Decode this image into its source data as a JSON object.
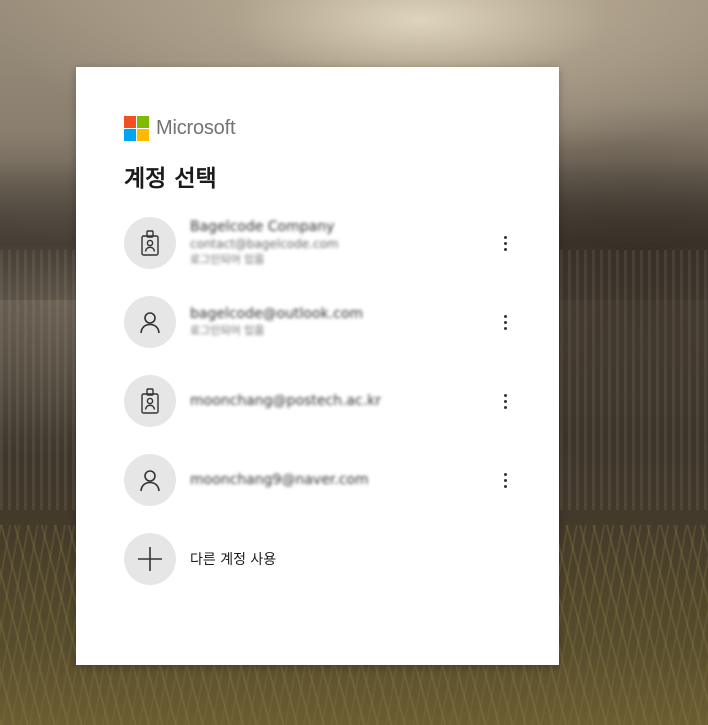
{
  "brand": {
    "name": "Microsoft",
    "logo_colors": [
      "#f25022",
      "#7fba00",
      "#00a4ef",
      "#ffb900"
    ]
  },
  "title": "계정 선택",
  "accounts": [
    {
      "type": "work",
      "icon": "badge-icon",
      "name": "Bagelcode Company",
      "email": "contact@bagelcode.com",
      "status": "로그인되어 있음"
    },
    {
      "type": "personal",
      "icon": "person-icon",
      "email": "bagelcode@outlook.com",
      "status": "로그인되어 있음"
    },
    {
      "type": "work",
      "icon": "badge-icon",
      "email": "moonchang@postech.ac.kr"
    },
    {
      "type": "personal",
      "icon": "person-icon",
      "email": "moonchang9@naver.com"
    }
  ],
  "add_account": {
    "icon": "plus-icon",
    "label": "다른 계정 사용"
  },
  "colors": {
    "avatar_bg": "#e6e6e6",
    "text": "#1b1b1b",
    "brand_text": "#737373"
  }
}
